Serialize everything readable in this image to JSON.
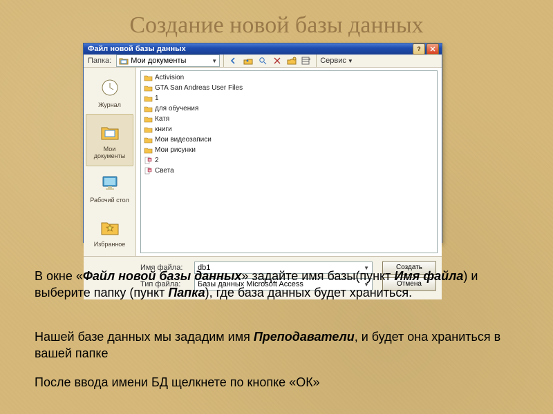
{
  "slide": {
    "title": "Создание новой базы данных"
  },
  "dialog": {
    "title": "Файл новой базы данных",
    "folder_label": "Папка:",
    "folder_selected": "Мои документы",
    "service_label": "Сервис",
    "places": [
      {
        "name": "Журнал"
      },
      {
        "name": "Мои документы"
      },
      {
        "name": "Рабочий стол"
      },
      {
        "name": "Избранное"
      }
    ],
    "items": [
      {
        "type": "folder",
        "label": "Activision"
      },
      {
        "type": "folder",
        "label": "GTA San Andreas User Files"
      },
      {
        "type": "folder",
        "label": "1"
      },
      {
        "type": "folder",
        "label": "для обучения"
      },
      {
        "type": "folder",
        "label": "Катя"
      },
      {
        "type": "folder",
        "label": "книги"
      },
      {
        "type": "folder",
        "label": "Мои видеозаписи"
      },
      {
        "type": "folder",
        "label": "Мои рисунки"
      },
      {
        "type": "db",
        "label": "2"
      },
      {
        "type": "db",
        "label": "Света"
      }
    ],
    "filename_label": "Имя файла:",
    "filename_value": "db1",
    "filetype_label": "Тип файла:",
    "filetype_value": "Базы данных Microsoft Access",
    "create_btn": "Создать",
    "cancel_btn": "Отмена"
  },
  "text": {
    "p1a": "В окне «",
    "p1b": "Файл новой базы данных",
    "p1c": "» задайте имя базы(пункт ",
    "p1d": "Имя файла",
    "p1e": ") и выберите папку (пункт ",
    "p1f": "Папка",
    "p1g": "), где база данных будет храниться.",
    "p2a": "Нашей базе данных мы зададим имя ",
    "p2b": "Преподаватели",
    "p2c": ", и будет она храниться в вашей папке",
    "p3": "После ввода имени БД щелкнете по кнопке «ОК»"
  },
  "icons": {
    "folder_color": "#f5c24a",
    "db_color": "#d6607a"
  }
}
